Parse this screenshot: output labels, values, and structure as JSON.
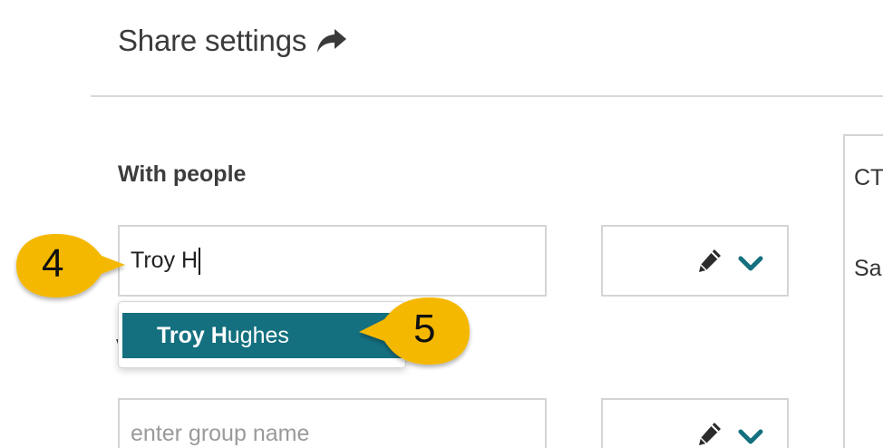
{
  "header": {
    "title": "Share settings",
    "icon": "share-forward-icon"
  },
  "with_people": {
    "label": "With people",
    "person_input_value": "Troy H",
    "group_input_placeholder": "enter group name"
  },
  "autocomplete": {
    "suggestion_bold": "Troy H",
    "suggestion_rest": "ughes"
  },
  "permissions": [
    {
      "edit_icon": "pencil-icon",
      "toggle_icon": "chevron-down-icon"
    },
    {
      "edit_icon": "pencil-icon",
      "toggle_icon": "chevron-down-icon"
    }
  ],
  "side_panel": {
    "line1": "CT",
    "line2": "Sa"
  },
  "callouts": {
    "step4": "4",
    "step5": "5"
  },
  "colors": {
    "accent": "#14707f",
    "callout": "#f5b800",
    "icon": "#2b2b2b",
    "chevron": "#14707f"
  }
}
